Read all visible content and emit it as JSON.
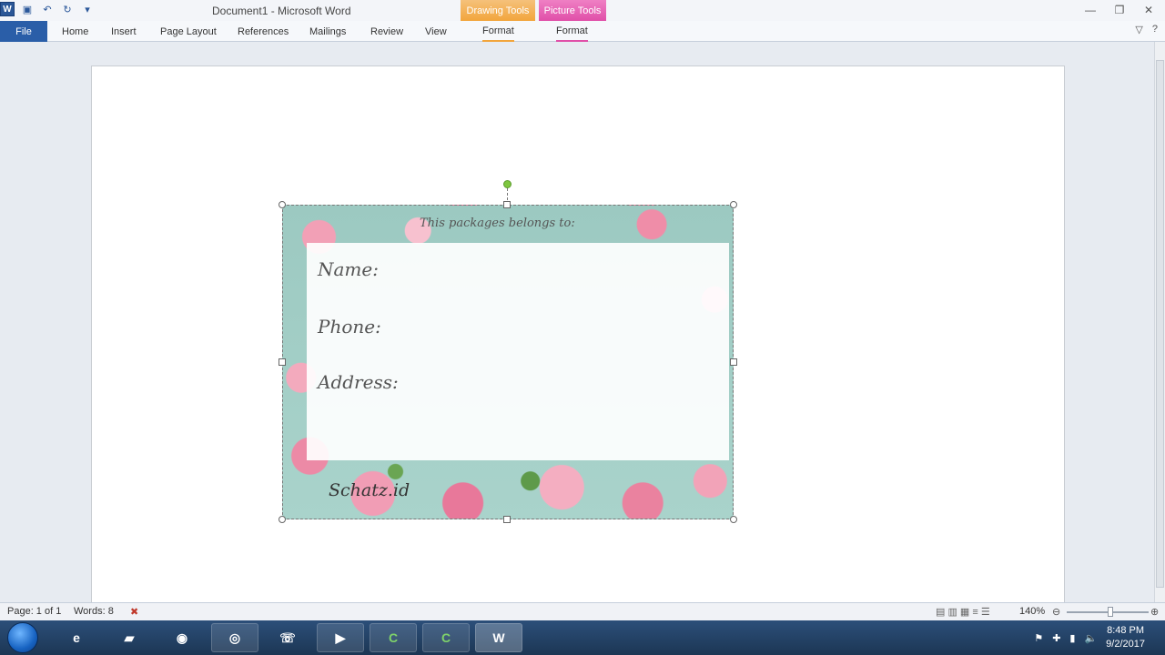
{
  "window": {
    "title": "Document1 - Microsoft Word",
    "app_icon": "word-icon",
    "context_tabs": {
      "drawing": "Drawing Tools",
      "picture": "Picture Tools"
    }
  },
  "quick_access": [
    "save-icon",
    "undo-icon",
    "redo-icon",
    "customize-icon"
  ],
  "ribbon": {
    "file": "File",
    "tabs": [
      "Home",
      "Insert",
      "Page Layout",
      "References",
      "Mailings",
      "Review",
      "View"
    ],
    "format_drawing": "Format",
    "format_picture": "Format"
  },
  "label": {
    "header": "This packages belongs to:",
    "fields": [
      "Name:",
      "Phone:",
      "Address:"
    ],
    "signature": "Schatz.id"
  },
  "status": {
    "page": "Page: 1 of 1",
    "words": "Words: 8",
    "zoom": "140%"
  },
  "taskbar": {
    "apps": [
      "internet-explorer-icon",
      "file-explorer-icon",
      "firefox-icon",
      "chrome-icon",
      "phone-icon",
      "media-player-icon",
      "camtasia-icon",
      "camtasia-icon",
      "word-icon"
    ],
    "time": "8:48 PM",
    "date": "9/2/2017"
  },
  "colors": {
    "file_tab": "#2a5ea8",
    "drawing_tools": "#f2a53c",
    "picture_tools": "#e04fa8"
  }
}
